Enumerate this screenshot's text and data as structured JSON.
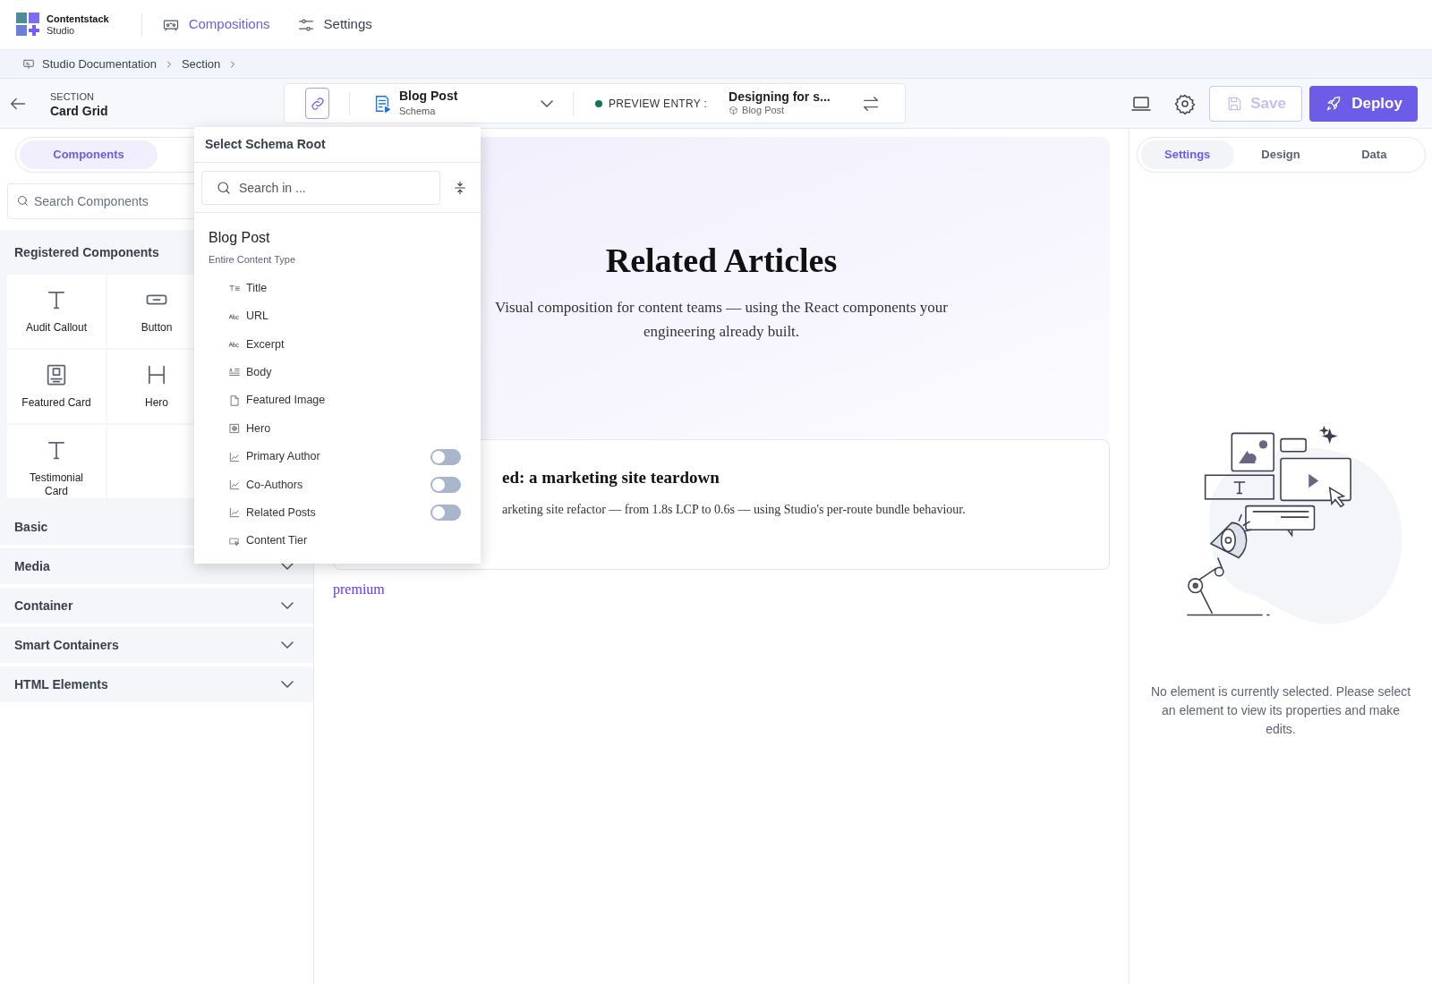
{
  "app": {
    "brand": "Contentstack",
    "product": "Studio"
  },
  "nav": [
    {
      "label": "Compositions",
      "selected": true,
      "kind": "compositions"
    },
    {
      "label": "Settings",
      "selected": false,
      "kind": "settings"
    }
  ],
  "breadcrumb": [
    "Studio Documentation",
    "Section"
  ],
  "header": {
    "kind_label": "SECTION",
    "title": "Card Grid"
  },
  "schema_picker": {
    "title": "Blog Post",
    "subtitle": "Schema"
  },
  "preview": {
    "label": "PREVIEW ENTRY :",
    "entry": "Designing for s...",
    "type": "Blog Post"
  },
  "actions": [
    {
      "label": "Save",
      "disabled": true,
      "kind": "save"
    },
    {
      "label": "Deploy",
      "disabled": false,
      "kind": "deploy"
    }
  ],
  "left_tabs": [
    {
      "label": "Components",
      "selected": true
    }
  ],
  "component_search": {
    "placeholder": "Search Components"
  },
  "registered": {
    "title": "Registered Components",
    "items": [
      {
        "label": "Audit Callout",
        "kind": "text"
      },
      {
        "label": "Button",
        "kind": "button"
      },
      {
        "label": "Featured Card",
        "kind": "card"
      },
      {
        "label": "Hero",
        "kind": "heading"
      },
      {
        "label": "Testimonial Card",
        "kind": "text"
      }
    ]
  },
  "categories": [
    {
      "label": "Basic"
    },
    {
      "label": "Media"
    },
    {
      "label": "Container"
    },
    {
      "label": "Smart Containers"
    },
    {
      "label": "HTML Elements"
    }
  ],
  "canvas": {
    "heading": "Related Articles",
    "intro": "Visual composition for content teams — using the React components your engineering already built.",
    "card_title": "ed: a marketing site teardown",
    "card_text": "arketing site refactor — from 1.8s LCP to 0.6s — using Studio's per-route bundle behaviour.",
    "tag": "premium"
  },
  "dropdown": {
    "title": "Select Schema Root",
    "search_placeholder": "Search in ...",
    "root": {
      "title": "Blog Post",
      "subtitle": "Entire Content Type"
    },
    "fields": [
      {
        "label": "Title",
        "kind": "title"
      },
      {
        "label": "URL",
        "kind": "text"
      },
      {
        "label": "Excerpt",
        "kind": "text"
      },
      {
        "label": "Body",
        "kind": "rich"
      },
      {
        "label": "Featured Image",
        "kind": "file"
      },
      {
        "label": "Hero",
        "kind": "group"
      },
      {
        "label": "Primary Author",
        "kind": "reference",
        "on": false
      },
      {
        "label": "Co-Authors",
        "kind": "reference",
        "on": false
      },
      {
        "label": "Related Posts",
        "kind": "reference",
        "on": false
      },
      {
        "label": "Content Tier",
        "kind": "select"
      }
    ]
  },
  "right_tabs": [
    {
      "label": "Settings",
      "selected": true
    },
    {
      "label": "Design",
      "selected": false
    },
    {
      "label": "Data",
      "selected": false
    }
  ],
  "empty_message": "No element is currently selected. Please select an element to view its properties and make edits."
}
